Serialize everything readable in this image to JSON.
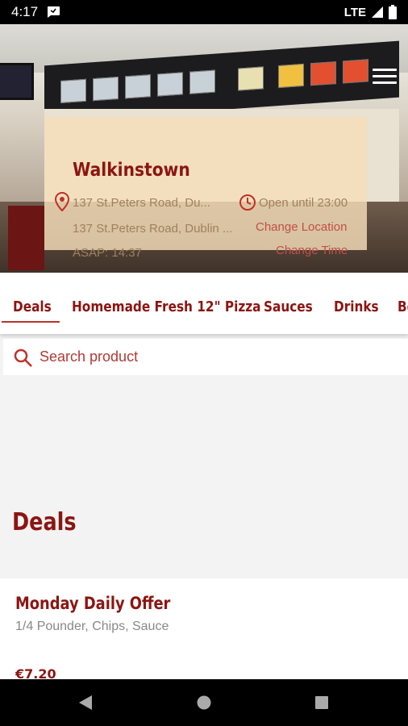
{
  "status_bar": {
    "time": "4:17",
    "network": "LTE"
  },
  "store": {
    "name": "Walkinstown",
    "address_short": "137 St.Peters Road, Du...",
    "address_full": "137 St.Peters Road, Dublin ...",
    "hours": "Open until 23:00",
    "change_location": "Change Location",
    "asap": "ASAP: 14:37",
    "change_time": "Change Time"
  },
  "tabs": [
    {
      "label": "Deals"
    },
    {
      "label": "Homemade Fresh 12\" Pizza"
    },
    {
      "label": "Sauces"
    },
    {
      "label": "Drinks"
    },
    {
      "label": "Bo"
    }
  ],
  "search": {
    "placeholder": "Search product"
  },
  "section": {
    "title": "Deals"
  },
  "product": {
    "name": "Monday Daily Offer",
    "description": "1/4 Pounder, Chips, Sauce",
    "price": "€7.20"
  },
  "colors": {
    "brand_red": "#8b1512",
    "accent_red": "#c0302a"
  }
}
